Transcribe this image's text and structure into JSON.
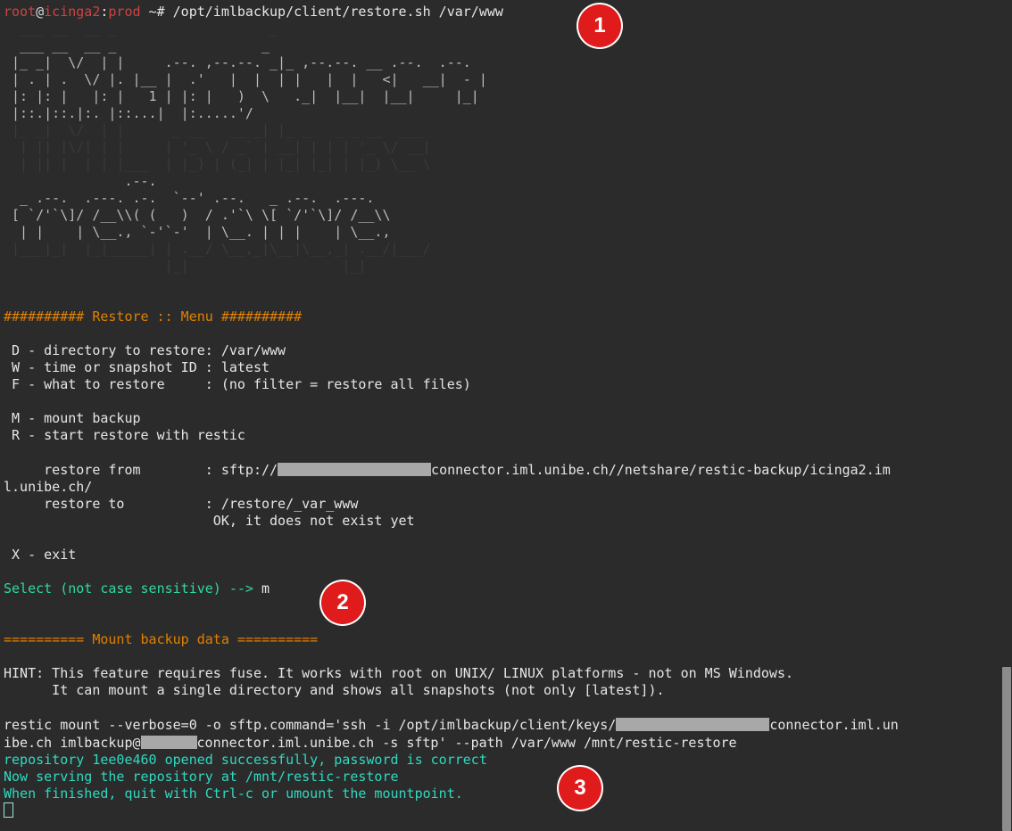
{
  "terminal": {
    "prompt": {
      "user": "root",
      "at": "@",
      "host": "icinga2",
      "colon": ":",
      "path_label": "prod",
      "tail": " ~# ",
      "command": "/opt/imlbackup/client/restore.sh /var/www"
    },
    "ascii_banner": [
      "  ___ __  __ _                   _                   ",
      " |_ _|  \\/  | |      _ __   __ _| |_ _   _ _ __  ___ ",
      "  | || |\\/| | |     | '_ \\ / _` | __| | | | '_ \\/ __|",
      "  | || |  | | |___  | |_) | (_| | |_| |_| | |_) \\__ \\",
      " |___|_|  |_|_____| | .__/ \\__,_|\\__|\\__,_| .__/|___/",
      "                    |_|                   |_|        "
    ],
    "ascii_banner_raw": [
      "  ___ __  __ _                  _                         ",
      " |_ _|  \\/  | |     .--. ,--.--. _|_ ,--.--. __ .--.  .--. ",
      " | . | .  \\/ |. |__ |  .'   |  |  | |   |  |   <|   __|  - |",
      " |: |: |   |: |   1 | |: |   )  \\   ._|  |__|  |__|     |_|",
      " |::.|::.|:. |::...|  |:.....'/                            "
    ],
    "ascii_restore": [
      "               .--.                             ",
      "  _ .--.  .---. .-.  `--' .--.   _ .--.  .---.  ",
      " [ `/'`\\]/ /__\\\\( (   )  / .'`\\ \\[ `/'`\\]/ /__\\\\ ",
      "  | |    | \\__., `-'`-'  | \\__. | | |    | \\__., ",
      " [___]    '.__.'          '.__.' [___]    '.__.' "
    ],
    "menu_header": "########## Restore :: Menu ##########",
    "menu_items": [
      " D - directory to restore: /var/www",
      " W - time or snapshot ID : latest",
      " F - what to restore     : (no filter = restore all files)",
      "",
      " M - mount backup",
      " R - start restore with restic"
    ],
    "restore_from_label": "     restore from        : sftp://",
    "restore_from_host": "connector.iml.unibe.ch//netshare/restic-backup/icinga2.im",
    "restore_from_wrap": "l.unibe.ch/",
    "restore_to_label": "     restore to          : /restore/_var_www",
    "restore_to_note": "                          OK, it does not exist yet",
    "exit_item": " X - exit",
    "select_prompt": "Select (not case sensitive) --> ",
    "select_answer": "m",
    "mount_header": "========== Mount backup data ==========",
    "hint_line1": "HINT: This feature requires fuse. It works with root on UNIX/ LINUX platforms - not on MS Windows.",
    "hint_line2": "      It can mount a single directory and shows all snapshots (not only [latest]).",
    "restic_cmd_part1": "restic mount --verbose=0 -o sftp.command='ssh -i /opt/imlbackup/client/keys/",
    "restic_cmd_part2": "connector.iml.un",
    "restic_cmd_line2_a": "ibe.ch imlbackup@",
    "restic_cmd_line2_b": "connector.iml.unibe.ch -s sftp' --path /var/www /mnt/restic-restore",
    "result_line1": "repository 1ee0e460 opened successfully, password is correct",
    "result_line2": "Now serving the repository at /mnt/restic-restore",
    "result_line3": "When finished, quit with Ctrl-c or umount the mountpoint."
  },
  "markers": {
    "one": "1",
    "two": "2",
    "three": "3"
  }
}
